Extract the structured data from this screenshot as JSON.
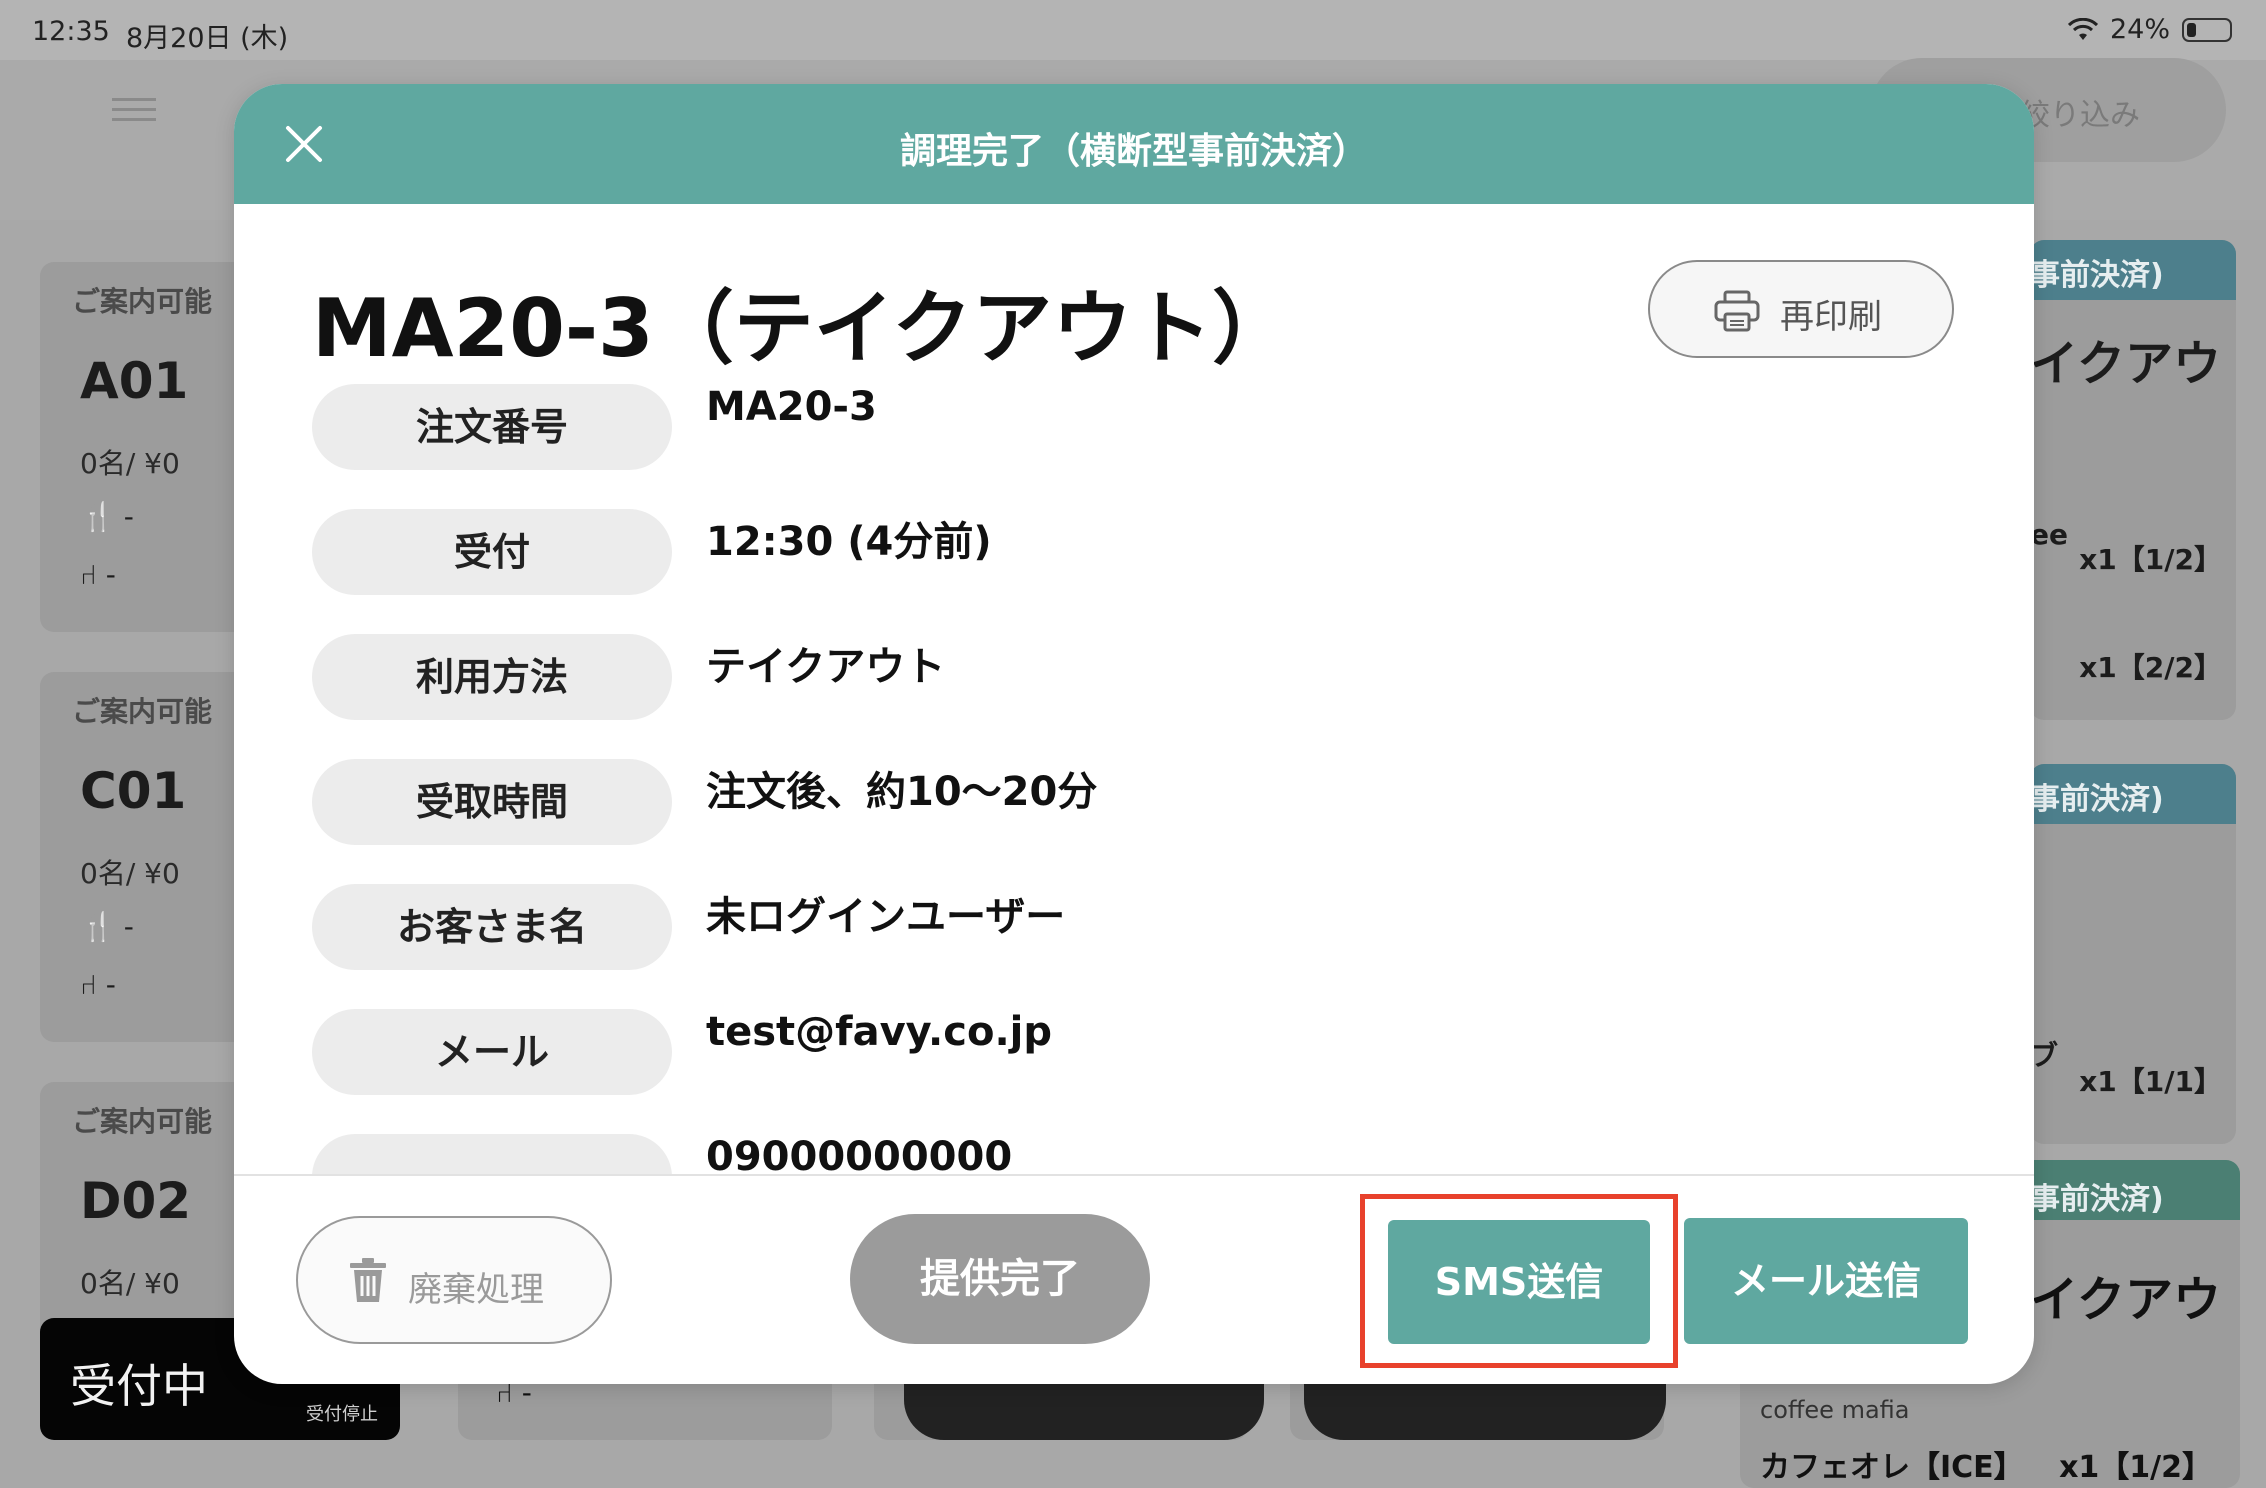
{
  "status_bar": {
    "time": "12:35",
    "date": "8月20日 (木)",
    "battery": "24%"
  },
  "background": {
    "filter_label": "絞り込み",
    "tables": [
      {
        "status": "ご案内可能",
        "name": "A01",
        "guests": "0名/ ¥0",
        "row1": "-",
        "row2": "-"
      },
      {
        "status": "ご案内可能",
        "name": "C01",
        "guests": "0名/ ¥0",
        "row1": "-",
        "row2": "-"
      },
      {
        "status": "ご案内可能",
        "name": "D02",
        "guests": "0名/ ¥0",
        "row1": "-",
        "row2": "-"
      }
    ],
    "reception": {
      "label": "受付中",
      "sub": "受付停止"
    },
    "bottom_row2": "-",
    "order_cards": [
      {
        "head": "事前決済)",
        "big": "イクアウ",
        "line1": "ee",
        "qty1": "x1【1/2】",
        "qty2": "x1【2/2】"
      },
      {
        "head": "事前決済)",
        "line1": "ブ",
        "qty1": "x1【1/1】"
      },
      {
        "head": "事前決済)",
        "big": "イクアウ",
        "shop": "coffee mafia",
        "item": "カフェオレ【ICE】",
        "qty": "x1【1/2】"
      }
    ]
  },
  "modal": {
    "title": "調理完了（横断型事前決済）",
    "order_title": "MA20-3（テイクアウト）",
    "reprint_label": "再印刷",
    "rows": [
      {
        "label": "注文番号",
        "value": "MA20-3"
      },
      {
        "label": "受付",
        "value": "12:30 (4分前)"
      },
      {
        "label": "利用方法",
        "value": "テイクアウト"
      },
      {
        "label": "受取時間",
        "value": "注文後、約10～20分"
      },
      {
        "label": "お客さま名",
        "value": "未ログインユーザー"
      },
      {
        "label": "メール",
        "value": "test@favy.co.jp"
      },
      {
        "label": "",
        "value": "09000000000"
      }
    ],
    "buttons": {
      "discard": "廃棄処理",
      "complete": "提供完了",
      "sms": "SMS送信",
      "mail": "メール送信"
    }
  },
  "colors": {
    "accent": "#5fa8a0",
    "highlight": "#e8412c",
    "disabled": "#9b9b9b"
  },
  "icons": [
    "close-icon",
    "printer-icon",
    "trash-icon",
    "cutlery-icon",
    "chair-icon",
    "wifi-icon",
    "battery-icon",
    "hamburger-icon"
  ]
}
